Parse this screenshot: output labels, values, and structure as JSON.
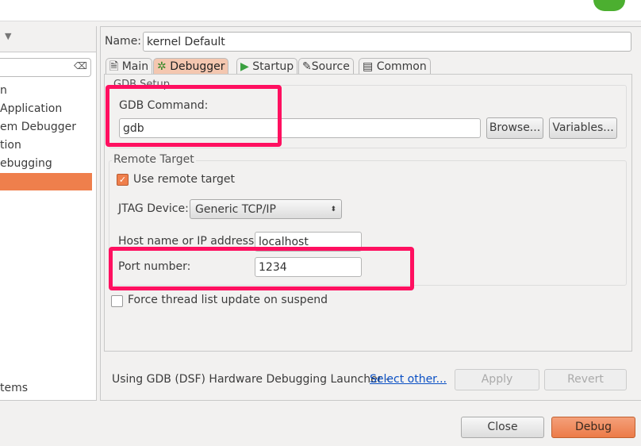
{
  "left": {
    "items": [
      "n",
      "Application",
      "em Debugger",
      "tion",
      "ebugging",
      "",
      "tems"
    ],
    "clear_icon": "clear-icon",
    "menu_icon": "chevron-down-icon"
  },
  "name_label": "Name:",
  "name_value": "kernel Default",
  "tabs": [
    "Main",
    "Debugger",
    "Startup",
    "Source",
    "Common"
  ],
  "gdb": {
    "group": "GDB Setup",
    "label": "GDB Command:",
    "value": "gdb",
    "browse": "Browse...",
    "variables": "Variables..."
  },
  "remote": {
    "group": "Remote Target",
    "use_remote": "Use remote target",
    "jtag_label": "JTAG Device:",
    "jtag_value": "Generic TCP/IP",
    "host_label": "Host name or IP address:",
    "host_value": "localhost",
    "port_label": "Port number:",
    "port_value": "1234"
  },
  "force_thread": "Force thread list update on suspend",
  "launcher_text": "Using GDB (DSF) Hardware Debugging Launcher -",
  "select_other": "Select other...",
  "apply": "Apply",
  "revert": "Revert",
  "close": "Close",
  "debug": "Debug"
}
